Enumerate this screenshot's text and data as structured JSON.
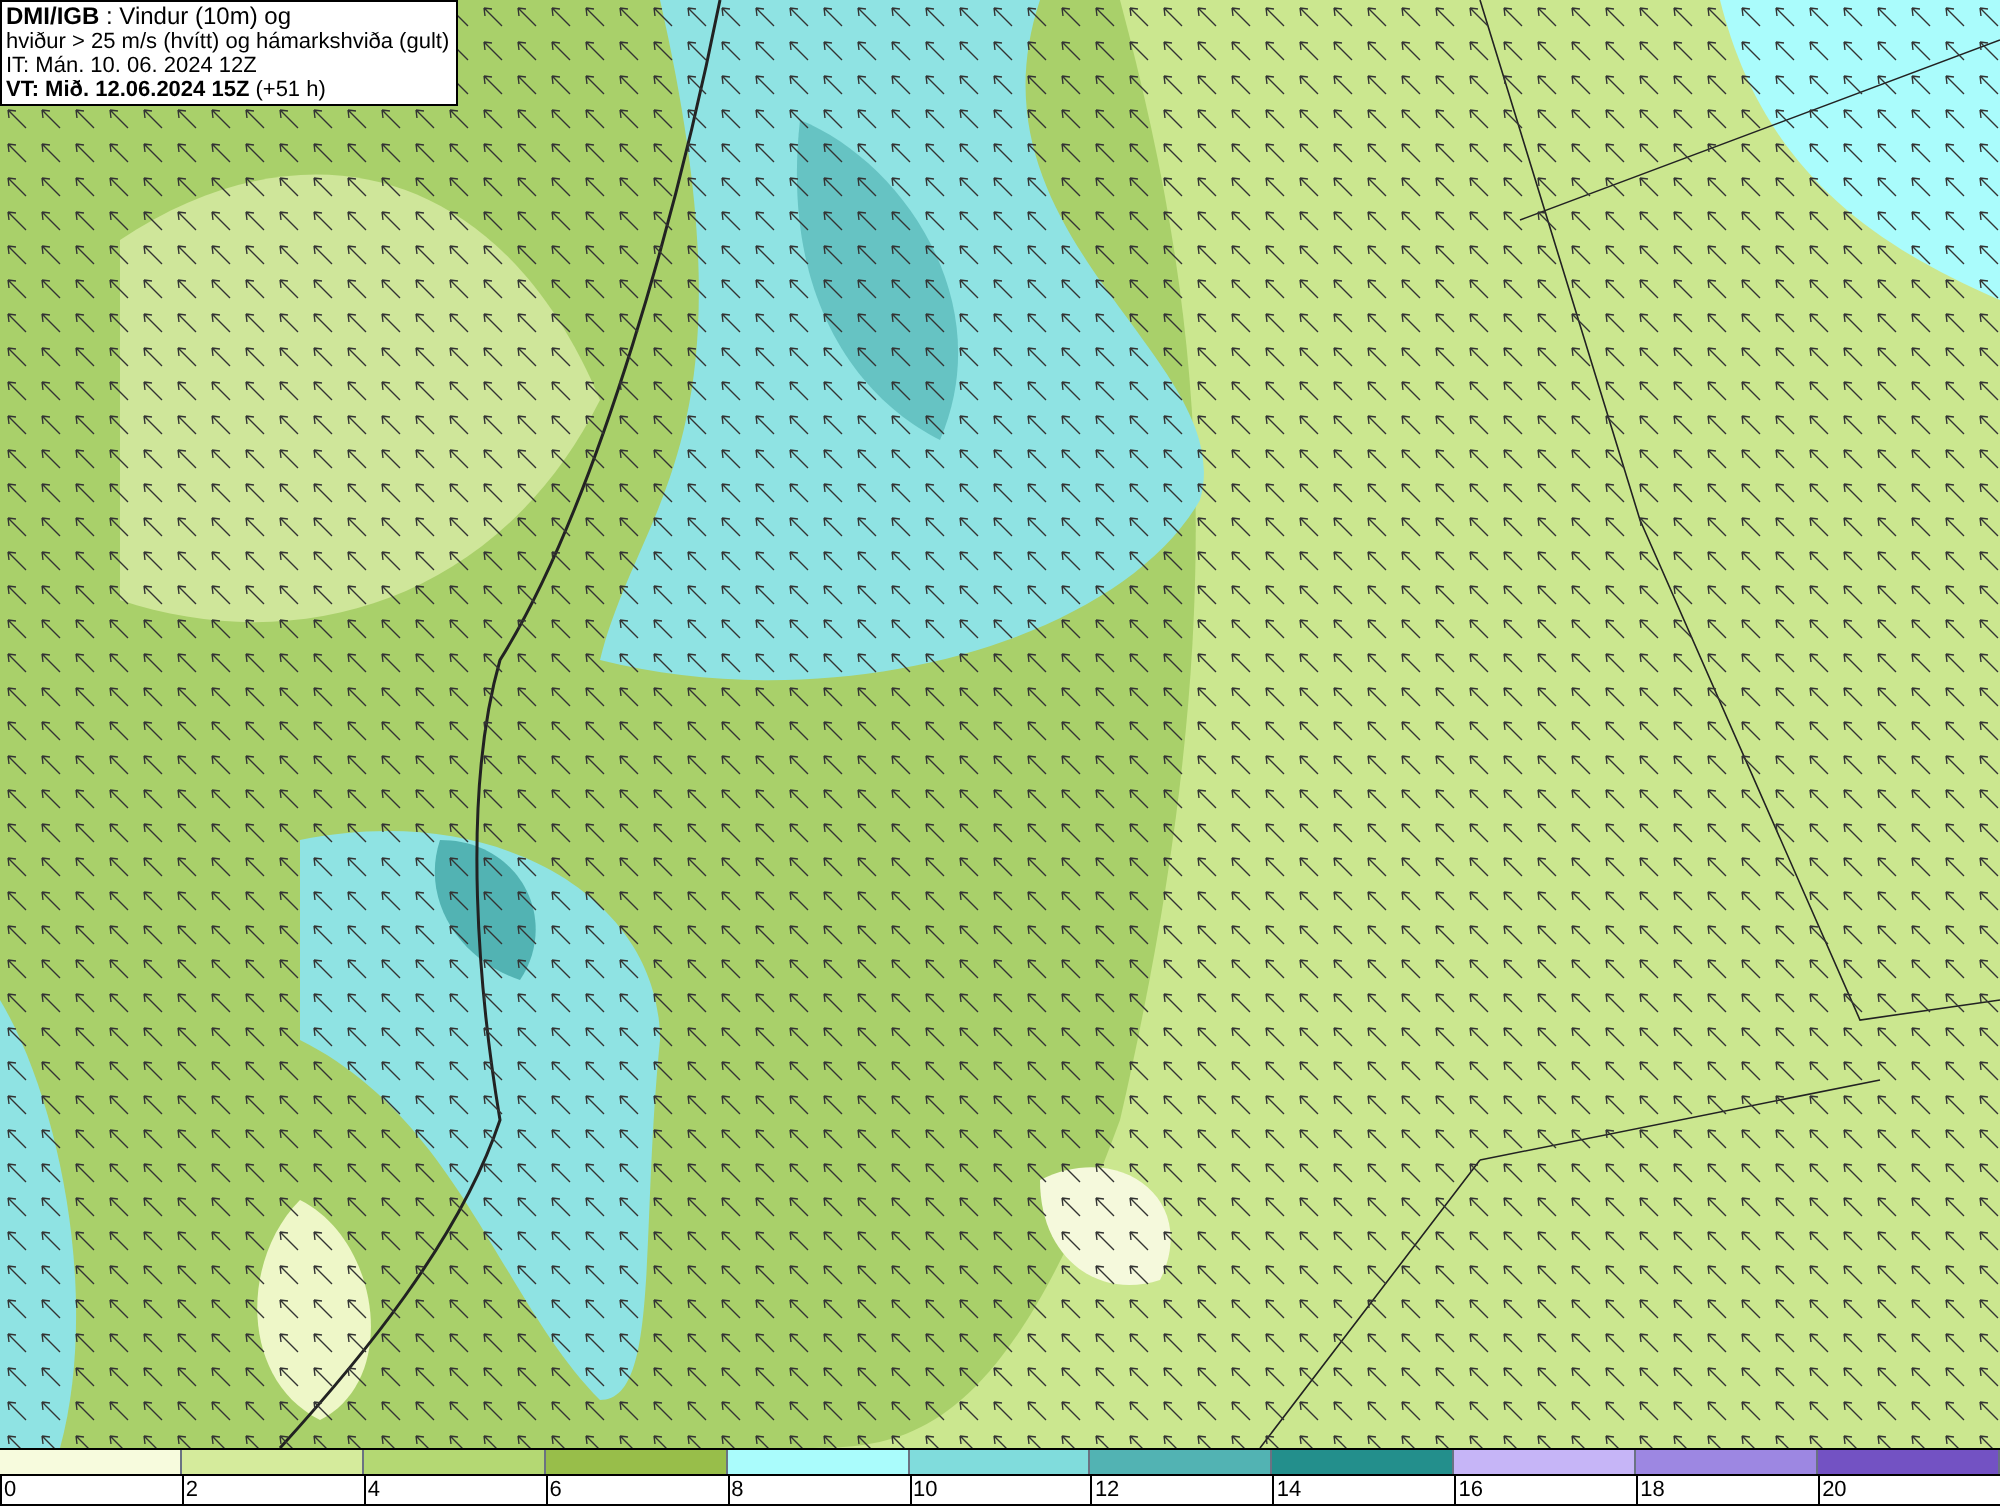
{
  "header": {
    "lines": [
      "**DMI/IGB** : Vindur (10m) og",
      "hviður > 25 m/s (hvítt) og hámarkshviða (gult)",
      "IT: Mán. 10. 06. 2024 12Z",
      "**VT: Mið. 12.06.2024 15Z** (+51 h)"
    ]
  },
  "legend": [
    {
      "label": "0",
      "color": "#f7fbdd"
    },
    {
      "label": "2",
      "color": "#d5eb9c"
    },
    {
      "label": "4",
      "color": "#b4d873"
    },
    {
      "label": "6",
      "color": "#98be4a"
    },
    {
      "label": "8",
      "color": "#aafcfc"
    },
    {
      "label": "10",
      "color": "#80dcdc"
    },
    {
      "label": "12",
      "color": "#52b3b3"
    },
    {
      "label": "14",
      "color": "#238f8c"
    },
    {
      "label": "16",
      "color": "#c6b5f7"
    },
    {
      "label": "18",
      "color": "#9d87e2"
    },
    {
      "label": "20",
      "color": "#7352c3"
    }
  ]
}
